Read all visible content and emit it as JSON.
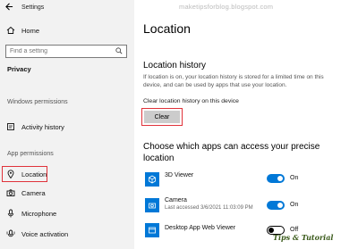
{
  "window": {
    "title": "Settings"
  },
  "sidebar": {
    "home_label": "Home",
    "search_placeholder": "Find a setting",
    "privacy_label": "Privacy",
    "windows_permissions_label": "Windows permissions",
    "activity_history_label": "Activity history",
    "app_permissions_label": "App permissions",
    "items": [
      {
        "label": "Location",
        "icon": "location-icon",
        "selected": true
      },
      {
        "label": "Camera",
        "icon": "camera-icon"
      },
      {
        "label": "Microphone",
        "icon": "microphone-icon"
      },
      {
        "label": "Voice activation",
        "icon": "voice-activation-icon"
      }
    ]
  },
  "main": {
    "watermark": "maketipsforblog.blogspot.com",
    "title": "Location",
    "history_heading": "Location history",
    "history_description": "If location is on, your location history is stored for a limited time on this device, and can be used by apps that use your location.",
    "clear_label": "Clear location history on this device",
    "clear_button": "Clear",
    "apps_heading": "Choose which apps can access your precise location",
    "apps": [
      {
        "name": "3D Viewer",
        "sub": "",
        "icon": "cube-icon",
        "state": "On",
        "on": true
      },
      {
        "name": "Camera",
        "sub": "Last accessed 3/6/2021 11:03:09 PM",
        "icon": "camera-icon",
        "state": "On",
        "on": true
      },
      {
        "name": "Desktop App Web Viewer",
        "sub": "",
        "icon": "app-window-icon",
        "state": "Off",
        "on": false
      }
    ],
    "tips_text": "Tips & Tutorial"
  },
  "colors": {
    "accent": "#0078d7",
    "highlight": "#e0323a",
    "sidebar_bg": "#f2f2f2"
  }
}
